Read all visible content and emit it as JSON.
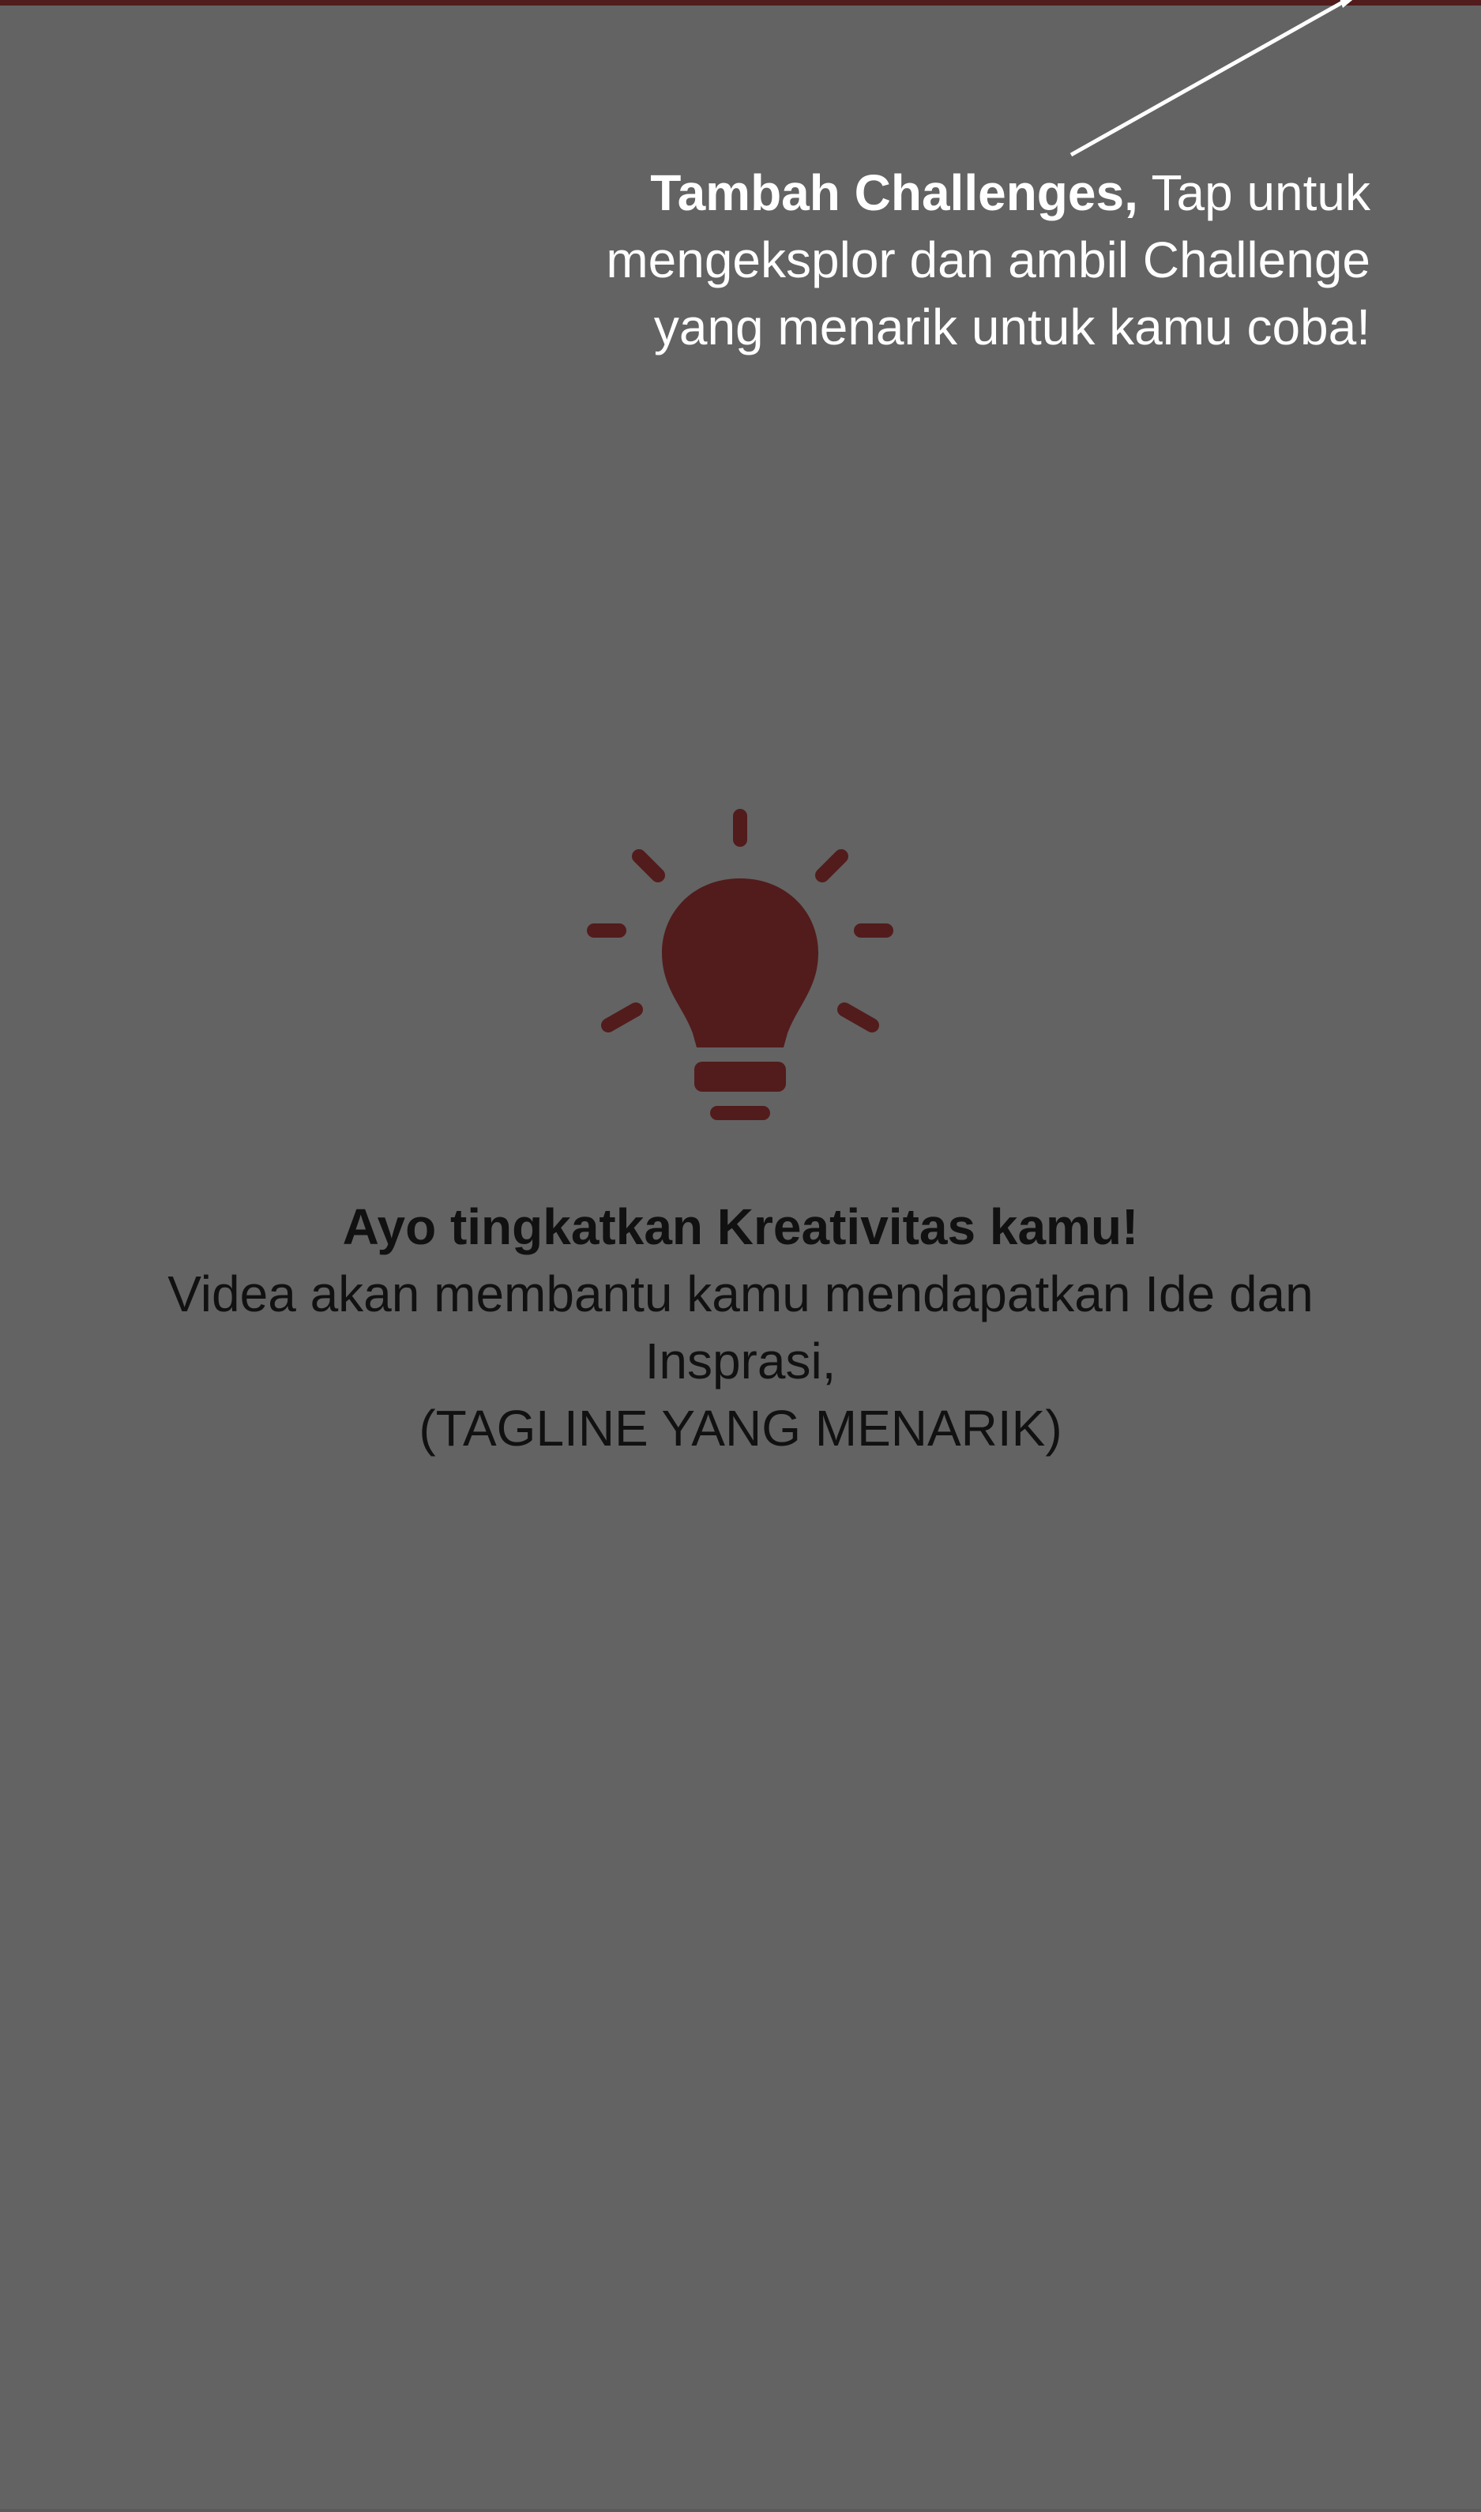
{
  "colors": {
    "overlay_background": "#636363",
    "accent": "#521c1c",
    "hint_text": "#ffffff",
    "body_text": "#111111"
  },
  "coach_mark": {
    "bold_label": "Tambah Challenges,",
    "text": " Tap untuk mengeksplor dan ambil Challenge yang menarik untuk kamu coba!"
  },
  "empty_state": {
    "icon": "lightbulb-icon",
    "title": "Ayo tingkatkan Kreativitas kamu!",
    "line1": "Videa akan membantu kamu mendapatkan Ide dan Insprasi,",
    "line2": "(TAGLINE YANG MENARIK)"
  }
}
